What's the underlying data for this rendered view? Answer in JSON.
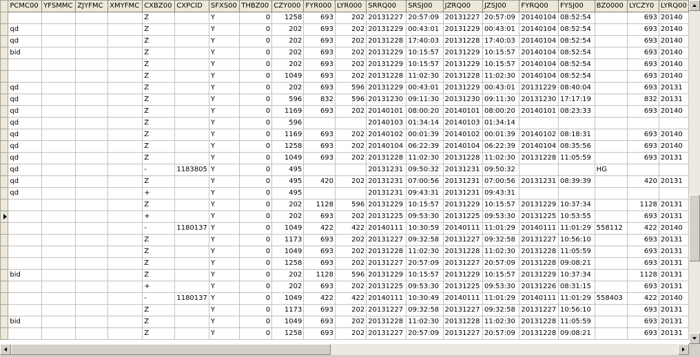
{
  "columns": [
    "PCMC00",
    "YFSMMC",
    "ZJYFMC",
    "XMYFMC",
    "CXBZ00",
    "CXPCID",
    "SFXS00",
    "THBZ00",
    "CZY000",
    "FYR000",
    "LYR000",
    "SRRQ00",
    "SRSJ00",
    "JZRQ00",
    "JZSJ00",
    "FYRQ00",
    "FYSJ00",
    "BZ0000",
    "LYCZY0",
    "LYRQ00"
  ],
  "current_row": 17,
  "rows": [
    [
      "",
      "",
      "",
      "",
      "Z",
      "",
      "Y",
      "0",
      "1258",
      "693",
      "202",
      "20131227",
      "20:57:09",
      "20131227",
      "20:57:09",
      "20140104",
      "08:52:54",
      "",
      "693",
      "20140"
    ],
    [
      "qd",
      "",
      "",
      "",
      "Z",
      "",
      "Y",
      "0",
      "202",
      "693",
      "202",
      "20131229",
      "00:43:01",
      "20131229",
      "00:43:01",
      "20140104",
      "08:52:54",
      "",
      "693",
      "20140"
    ],
    [
      "qd",
      "",
      "",
      "",
      "Z",
      "",
      "Y",
      "0",
      "202",
      "693",
      "202",
      "20131228",
      "17:40:03",
      "20131228",
      "17:40:03",
      "20140104",
      "08:52:54",
      "",
      "693",
      "20140"
    ],
    [
      "bid",
      "",
      "",
      "",
      "Z",
      "",
      "Y",
      "0",
      "202",
      "693",
      "202",
      "20131229",
      "10:15:57",
      "20131229",
      "10:15:57",
      "20140104",
      "08:52:54",
      "",
      "693",
      "20140"
    ],
    [
      "",
      "",
      "",
      "",
      "Z",
      "",
      "Y",
      "0",
      "202",
      "693",
      "202",
      "20131229",
      "10:15:57",
      "20131229",
      "10:15:57",
      "20140104",
      "08:52:54",
      "",
      "693",
      "20140"
    ],
    [
      "",
      "",
      "",
      "",
      "Z",
      "",
      "Y",
      "0",
      "1049",
      "693",
      "202",
      "20131228",
      "11:02:30",
      "20131228",
      "11:02:30",
      "20140104",
      "08:52:54",
      "",
      "693",
      "20140"
    ],
    [
      "qd",
      "",
      "",
      "",
      "Z",
      "",
      "Y",
      "0",
      "202",
      "693",
      "596",
      "20131229",
      "00:43:01",
      "20131229",
      "00:43:01",
      "20131229",
      "08:40:04",
      "",
      "693",
      "20131"
    ],
    [
      "qd",
      "",
      "",
      "",
      "Z",
      "",
      "Y",
      "0",
      "596",
      "832",
      "596",
      "20131230",
      "09:11:30",
      "20131230",
      "09:11:30",
      "20131230",
      "17:17:19",
      "",
      "832",
      "20131"
    ],
    [
      "qd",
      "",
      "",
      "",
      "Z",
      "",
      "Y",
      "0",
      "1169",
      "693",
      "202",
      "20140101",
      "08:00:20",
      "20140101",
      "08:00:20",
      "20140101",
      "08:23:33",
      "",
      "693",
      "20140"
    ],
    [
      "qd",
      "",
      "",
      "",
      "Z",
      "",
      "Y",
      "0",
      "596",
      "",
      "",
      "20140103",
      "01:34:14",
      "20140103",
      "01:34:14",
      "",
      "",
      "",
      "",
      ""
    ],
    [
      "qd",
      "",
      "",
      "",
      "Z",
      "",
      "Y",
      "0",
      "1169",
      "693",
      "202",
      "20140102",
      "00:01:39",
      "20140102",
      "00:01:39",
      "20140102",
      "08:18:31",
      "",
      "693",
      "20140"
    ],
    [
      "qd",
      "",
      "",
      "",
      "Z",
      "",
      "Y",
      "0",
      "1258",
      "693",
      "202",
      "20140104",
      "06:22:39",
      "20140104",
      "06:22:39",
      "20140104",
      "08:35:56",
      "",
      "693",
      "20140"
    ],
    [
      "qd",
      "",
      "",
      "",
      "Z",
      "",
      "Y",
      "0",
      "1049",
      "693",
      "202",
      "20131228",
      "11:02:30",
      "20131228",
      "11:02:30",
      "20131228",
      "11:05:59",
      "",
      "693",
      "20131"
    ],
    [
      "qd",
      "",
      "",
      "",
      "-",
      "1183805",
      "Y",
      "0",
      "495",
      "",
      "",
      "20131231",
      "09:50:32",
      "20131231",
      "09:50:32",
      "",
      "",
      "HG",
      "",
      ""
    ],
    [
      "qd",
      "",
      "",
      "",
      "Z",
      "",
      "Y",
      "0",
      "495",
      "420",
      "202",
      "20131231",
      "07:00:56",
      "20131231",
      "07:00:56",
      "20131231",
      "08:39:39",
      "",
      "420",
      "20131"
    ],
    [
      "qd",
      "",
      "",
      "",
      "+",
      "",
      "Y",
      "0",
      "495",
      "",
      "",
      "20131231",
      "09:43:31",
      "20131231",
      "09:43:31",
      "",
      "",
      "",
      "",
      ""
    ],
    [
      "",
      "",
      "",
      "",
      "Z",
      "",
      "Y",
      "0",
      "202",
      "1128",
      "596",
      "20131229",
      "10:15:57",
      "20131229",
      "10:15:57",
      "20131229",
      "10:37:34",
      "",
      "1128",
      "20131"
    ],
    [
      "",
      "",
      "",
      "",
      "+",
      "",
      "Y",
      "0",
      "202",
      "693",
      "202",
      "20131225",
      "09:53:30",
      "20131225",
      "09:53:30",
      "20131225",
      "10:53:55",
      "",
      "693",
      "20131"
    ],
    [
      "",
      "",
      "",
      "",
      "-",
      "1180137",
      "Y",
      "0",
      "1049",
      "422",
      "422",
      "20140111",
      "10:30:59",
      "20140111",
      "11:01:29",
      "20140111",
      "11:01:29",
      "558112",
      "422",
      "20140"
    ],
    [
      "",
      "",
      "",
      "",
      "Z",
      "",
      "Y",
      "0",
      "1173",
      "693",
      "202",
      "20131227",
      "09:32:58",
      "20131227",
      "09:32:58",
      "20131227",
      "10:56:10",
      "",
      "693",
      "20131"
    ],
    [
      "",
      "",
      "",
      "",
      "Z",
      "",
      "Y",
      "0",
      "1049",
      "693",
      "202",
      "20131228",
      "11:02:30",
      "20131228",
      "11:02:30",
      "20131228",
      "11:05:59",
      "",
      "693",
      "20131"
    ],
    [
      "",
      "",
      "",
      "",
      "Z",
      "",
      "Y",
      "0",
      "1258",
      "693",
      "202",
      "20131227",
      "20:57:09",
      "20131227",
      "20:57:09",
      "20131228",
      "09:08:21",
      "",
      "693",
      "20131"
    ],
    [
      "bid",
      "",
      "",
      "",
      "Z",
      "",
      "Y",
      "0",
      "202",
      "1128",
      "596",
      "20131229",
      "10:15:57",
      "20131229",
      "10:15:57",
      "20131229",
      "10:37:34",
      "",
      "1128",
      "20131"
    ],
    [
      "",
      "",
      "",
      "",
      "+",
      "",
      "Y",
      "0",
      "202",
      "693",
      "202",
      "20131225",
      "09:53:30",
      "20131225",
      "09:53:30",
      "20131226",
      "08:31:15",
      "",
      "693",
      "20131"
    ],
    [
      "",
      "",
      "",
      "",
      "-",
      "1180137",
      "Y",
      "0",
      "1049",
      "422",
      "422",
      "20140111",
      "10:30:49",
      "20140111",
      "11:01:29",
      "20140111",
      "11:01:29",
      "558403",
      "422",
      "20140"
    ],
    [
      "",
      "",
      "",
      "",
      "Z",
      "",
      "Y",
      "0",
      "1173",
      "693",
      "202",
      "20131227",
      "09:32:58",
      "20131227",
      "09:32:58",
      "20131227",
      "10:56:10",
      "",
      "693",
      "20131"
    ],
    [
      "bid",
      "",
      "",
      "",
      "Z",
      "",
      "Y",
      "0",
      "1049",
      "693",
      "202",
      "20131228",
      "11:02:30",
      "20131228",
      "11:02:30",
      "20131228",
      "11:05:59",
      "",
      "693",
      "20131"
    ],
    [
      "",
      "",
      "",
      "",
      "Z",
      "",
      "Y",
      "0",
      "1258",
      "693",
      "202",
      "20131227",
      "20:57:09",
      "20131227",
      "20:57:09",
      "20131228",
      "09:08:21",
      "",
      "693",
      "20131"
    ]
  ],
  "vertical_scroll_fraction": 0.72,
  "horizontal_scroll_fraction": 0.0
}
